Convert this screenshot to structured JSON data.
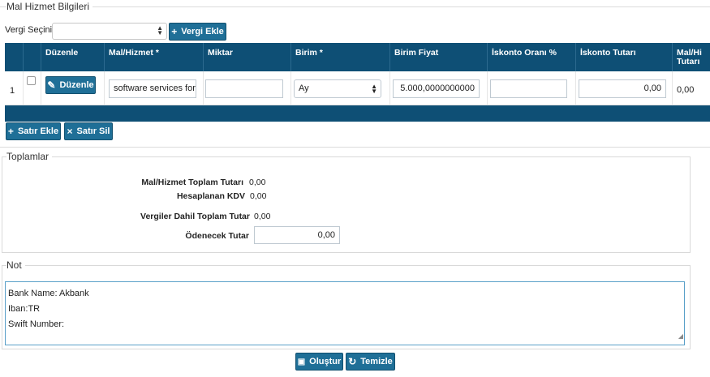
{
  "section_title": "Mal Hizmet Bilgileri",
  "vergi": {
    "label": "Vergi Seçiniz:",
    "selected": "",
    "add_button": "Vergi Ekle"
  },
  "table": {
    "headers": [
      "",
      "Düzenle",
      "Mal/Hizmet *",
      "Miktar",
      "Birim *",
      "Birim Fiyat",
      "İskonto Oranı %",
      "İskonto Tutarı",
      "Mal/Hizmet Tutarı"
    ],
    "header_visible": [
      "",
      "Düzenle",
      "Mal/Hizmet *",
      "Miktar",
      "Birim *",
      "Birim Fiyat",
      "İskonto Oranı %",
      "İskonto Tutarı",
      "Mal/Hi\nTutarı"
    ],
    "rows": [
      {
        "index": "1",
        "edit_label": "Düzenle",
        "mal_hizmet": "software services for J",
        "miktar": "",
        "birim": "Ay",
        "birim_fiyat": "5.000,0000000000",
        "iskonto_orani": "",
        "iskonto_tutari": "0,00",
        "tutar": "0,00"
      }
    ]
  },
  "row_actions": {
    "add": "Satır Ekle",
    "delete": "Satır Sil"
  },
  "totals": {
    "title": "Toplamlar",
    "mal_hizmet_label": "Mal/Hizmet Toplam Tutarı",
    "mal_hizmet_value": "0,00",
    "kdv_label": "Hesaplanan KDV",
    "kdv_value": "0,00",
    "vergiler_label": "Vergiler Dahil Toplam Tutar",
    "vergiler_value": "0,00",
    "odenecek_label": "Ödenecek Tutar",
    "odenecek_value": "0,00"
  },
  "note": {
    "title": "Not",
    "lines": [
      "Bank Name: Akbank",
      "Iban:TR",
      "Swift Number:"
    ]
  },
  "footer": {
    "create": "Oluştur",
    "clear": "Temizle"
  },
  "colors": {
    "header_bg": "#0e4f75",
    "button_bg": "#1f6f97"
  }
}
